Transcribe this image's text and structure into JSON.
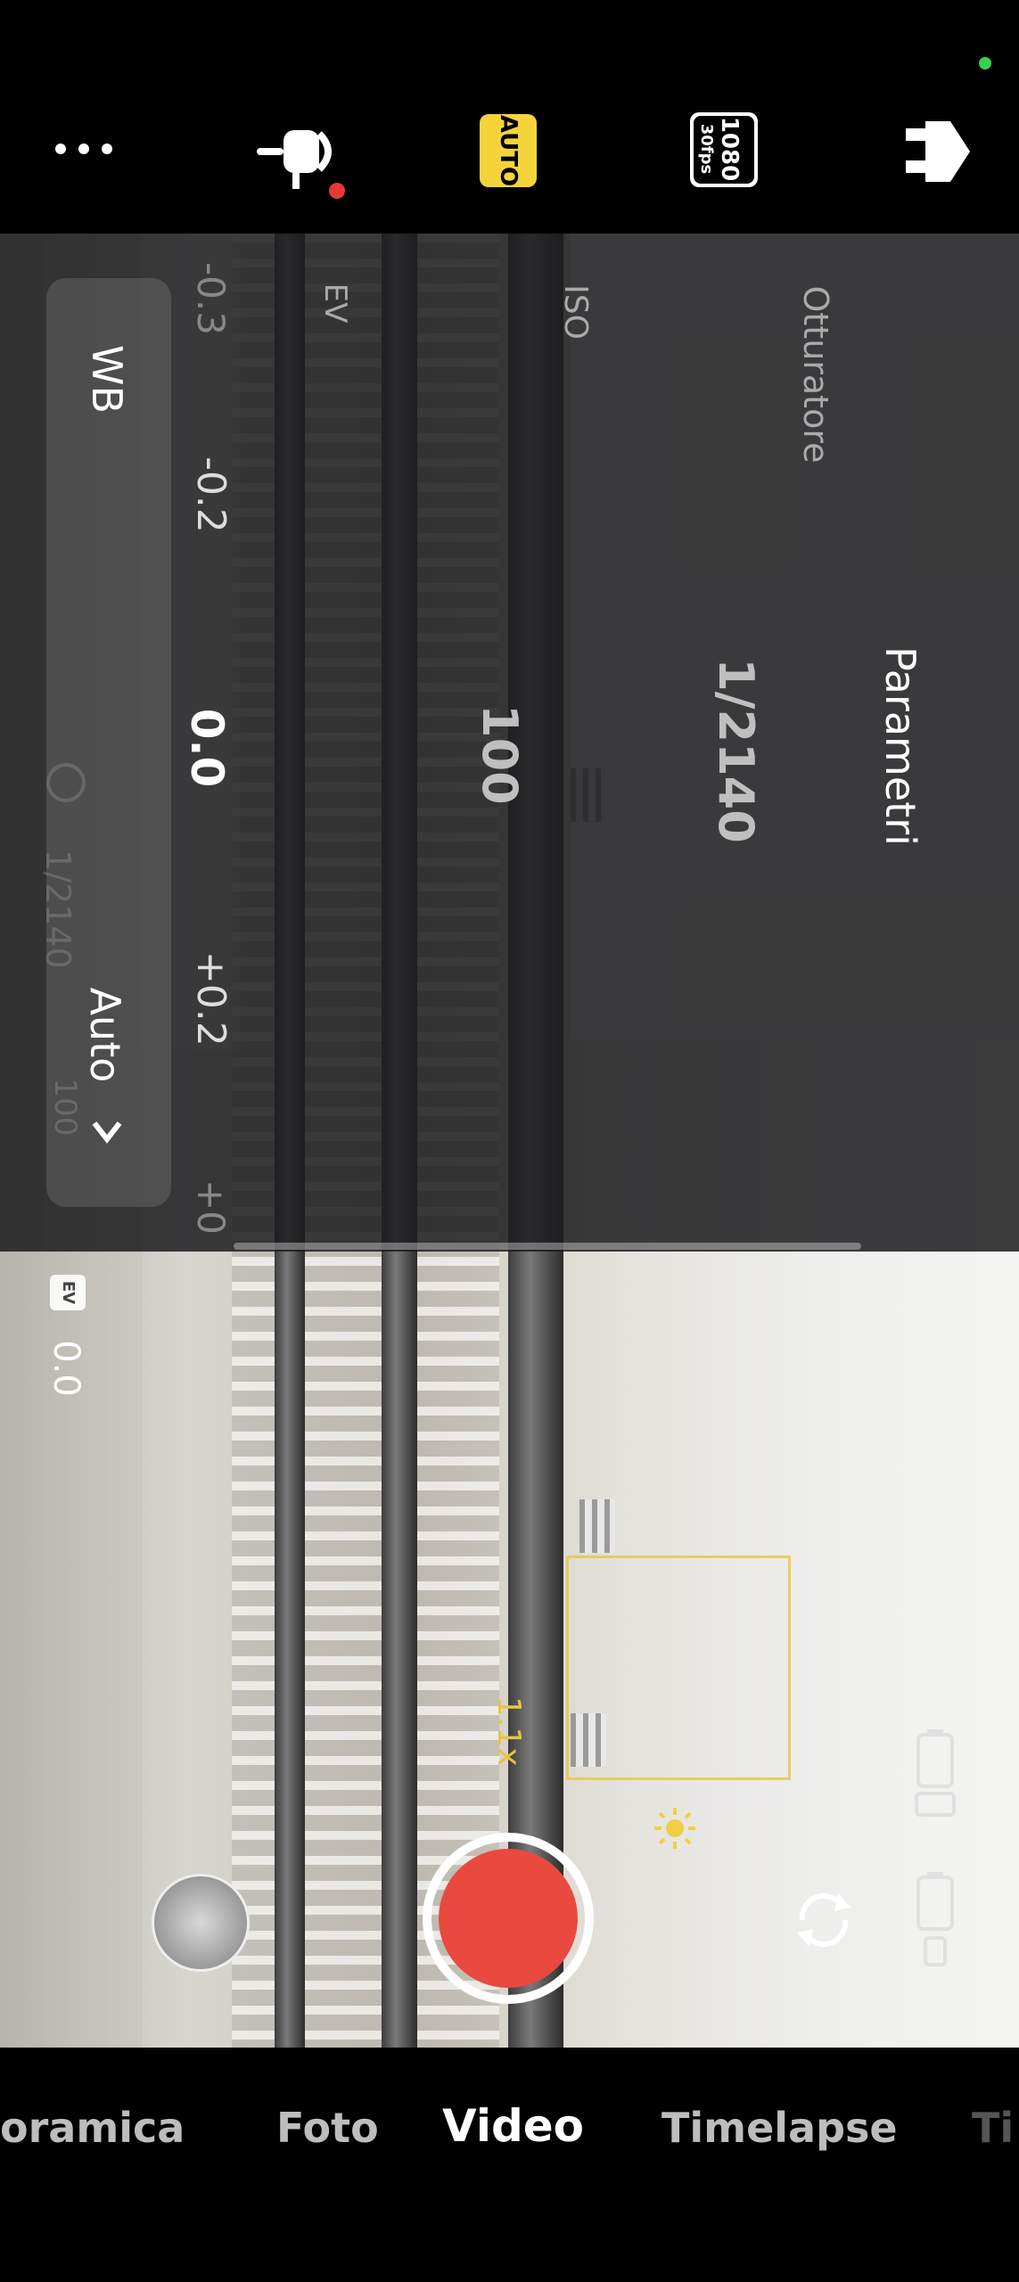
{
  "top_bar": {
    "icons": [
      "more-icon",
      "microphone-icon",
      "auto-mode-icon",
      "resolution-icon",
      "plugin-icon"
    ],
    "auto_badge": "AUTO",
    "resolution_top": "1080",
    "resolution_bottom": "30fps"
  },
  "parametri": {
    "title": "Parametri",
    "shutter_label": "Otturatore",
    "shutter_value": "1/2140",
    "iso_label": "ISO",
    "iso_value": "100",
    "ev_label": "EV",
    "ev_minus": "-0.2",
    "ev_value": "0.0",
    "ev_plus": "+0.2",
    "ev_far_minus": "-0.3",
    "ev_far_plus": "+0",
    "wb_label": "WB",
    "wb_value": "Auto",
    "ghost_shutter": "1/2140",
    "ghost_iso": "100"
  },
  "viewfinder": {
    "ev_badge": "EV",
    "ev_value": "0.0",
    "zoom": "1.1x"
  },
  "modes": {
    "items": [
      "oramica",
      "Foto",
      "Video",
      "Timelapse",
      "Ti"
    ],
    "active": "Video"
  },
  "colors": {
    "record": "#e9493f",
    "accent_yellow": "#f5d43b",
    "status_green": "#3ccf4e"
  }
}
